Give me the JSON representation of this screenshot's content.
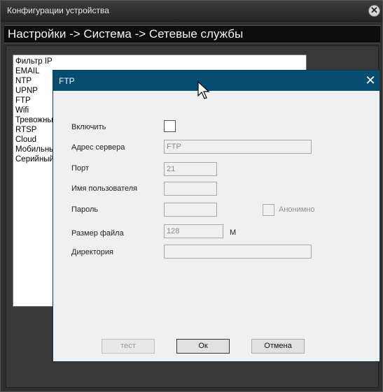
{
  "window": {
    "title": "Конфигурации устройства",
    "close_label": "✕"
  },
  "breadcrumb": "Настройки -> Система -> Сетевые службы",
  "services_list": [
    "Фильтр IP",
    "EMAIL",
    "NTP",
    "UPNP",
    "FTP",
    "Wifi",
    "Тревожны",
    "RTSP",
    "Cloud",
    "Мобильны",
    "Серийный"
  ],
  "dialog": {
    "title": "FTP",
    "close_label": "✕",
    "enable_label": "Включить",
    "enable_checked": false,
    "server_label": "Адрес сервера",
    "server_value": "FTP",
    "port_label": "Порт",
    "port_value": "21",
    "username_label": "Имя пользователя",
    "username_value": "",
    "password_label": "Пароль",
    "password_value": "",
    "anonymous_label": "Анонимно",
    "anonymous_checked": false,
    "filesize_label": "Размер файла",
    "filesize_value": "128",
    "filesize_unit": "М",
    "directory_label": "Директория",
    "directory_value": "",
    "test_button": "тест",
    "ok_button": "Ок",
    "cancel_button": "Отмена"
  }
}
